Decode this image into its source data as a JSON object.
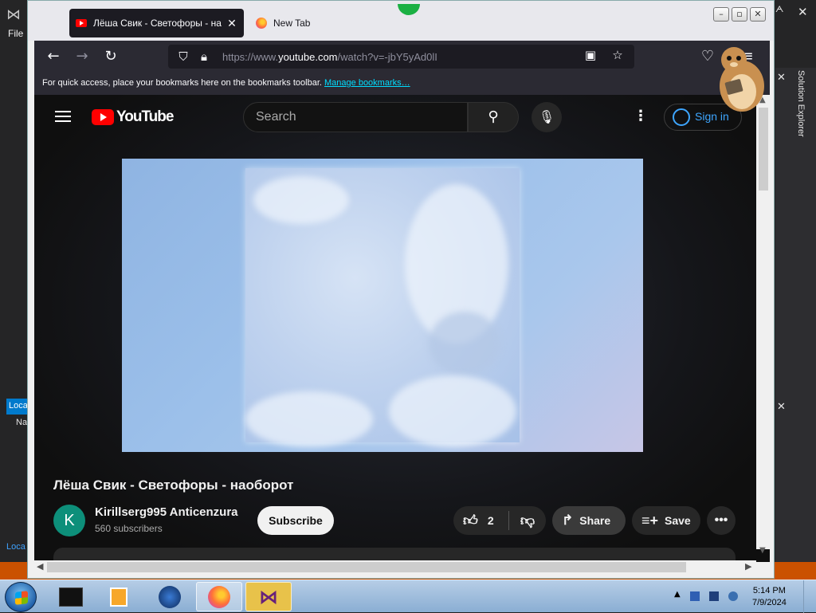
{
  "vs": {
    "menu_file": "File",
    "solution_explorer": "Solution Explorer",
    "local_tab": "Loca",
    "local_tab2": "Loca",
    "name_col": "Na"
  },
  "browser": {
    "tabs": [
      {
        "title": "Лёша Свик - Светофоры - наоборот",
        "icon": "youtube-favicon",
        "active": true
      },
      {
        "title": "New Tab",
        "icon": "firefox-favicon",
        "active": false
      }
    ],
    "url_prefix": "https://www.",
    "url_host": "youtube.com",
    "url_rest": "/watch?v=-jbY5yAd0lI",
    "bookmarks_text": "For quick access, place your bookmarks here on the bookmarks toolbar.",
    "bookmarks_link": "Manage bookmarks…"
  },
  "youtube": {
    "logo_text": "YouTube",
    "search_placeholder": "Search",
    "sign_in": "Sign in",
    "video_title": "Лёша Свик - Светофоры - наоборот",
    "channel_initial": "K",
    "channel_name": "Kirillserg995 Anticenzura",
    "subscribers": "560 subscribers",
    "subscribe_label": "Subscribe",
    "like_count": "2",
    "share_label": "Share",
    "save_label": "Save"
  },
  "taskbar": {
    "time": "5:14 PM",
    "date": "7/9/2024"
  },
  "colors": {
    "accent_red": "#ff0000",
    "link_blue": "#3ea6ff",
    "vs_orange": "#ca5100",
    "vs_blue": "#007acc"
  }
}
